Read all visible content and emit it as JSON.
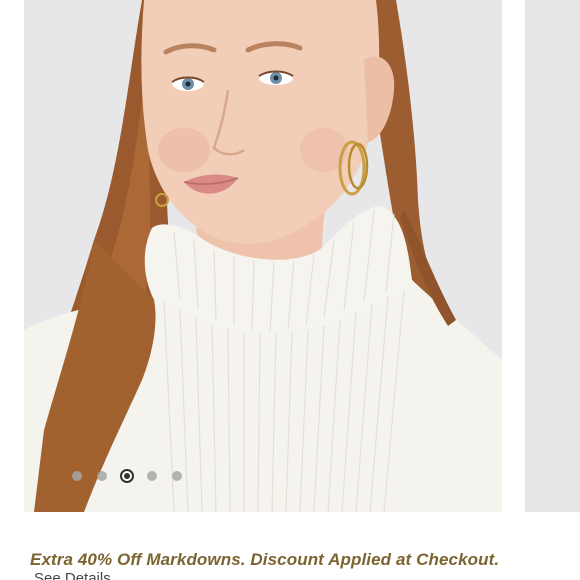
{
  "carousel": {
    "slide_count": 5,
    "active_index": 2,
    "image_description": "model-white-ribbed-turtleneck"
  },
  "promo": {
    "text": "Extra 40% Off Markdowns. Discount Applied at Checkout.",
    "details_link": "See Details",
    "color": "#7b6430"
  }
}
